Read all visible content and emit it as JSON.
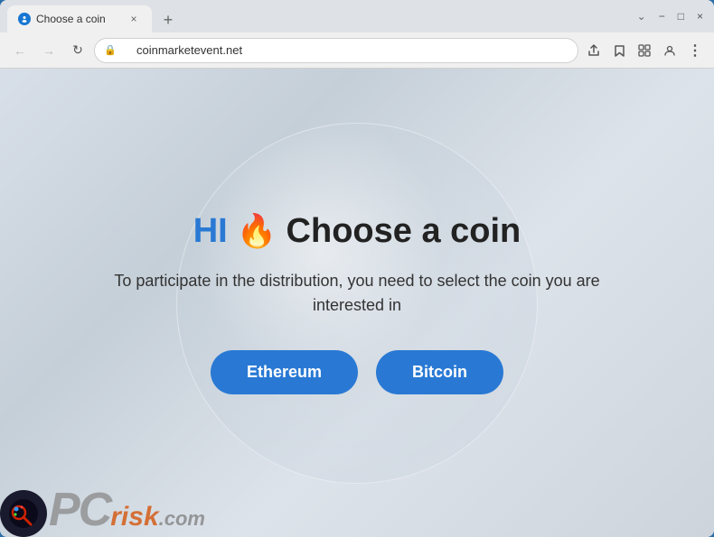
{
  "browser": {
    "tab": {
      "label": "Choose a coin",
      "favicon": "🔵",
      "close_label": "×"
    },
    "new_tab_label": "+",
    "window_controls": {
      "minimize": "−",
      "maximize": "□",
      "close": "×"
    },
    "nav": {
      "back": "←",
      "forward": "→",
      "reload": "↻"
    },
    "address": "coinmarketevent.net",
    "address_icons": {
      "share": "⬆",
      "bookmark": "☆",
      "extensions": "🧩",
      "profile": "👤",
      "menu": "⋮"
    }
  },
  "page": {
    "headline_hi": "HI",
    "headline_fire": "🔥",
    "headline_rest": "Choose a coin",
    "subtitle": "To participate in the distribution, you need to select the coin you are interested in",
    "buttons": {
      "ethereum": "Ethereum",
      "bitcoin": "Bitcoin"
    }
  },
  "watermark": {
    "pc": "PC",
    "risk": "risk",
    "com": ".com"
  }
}
